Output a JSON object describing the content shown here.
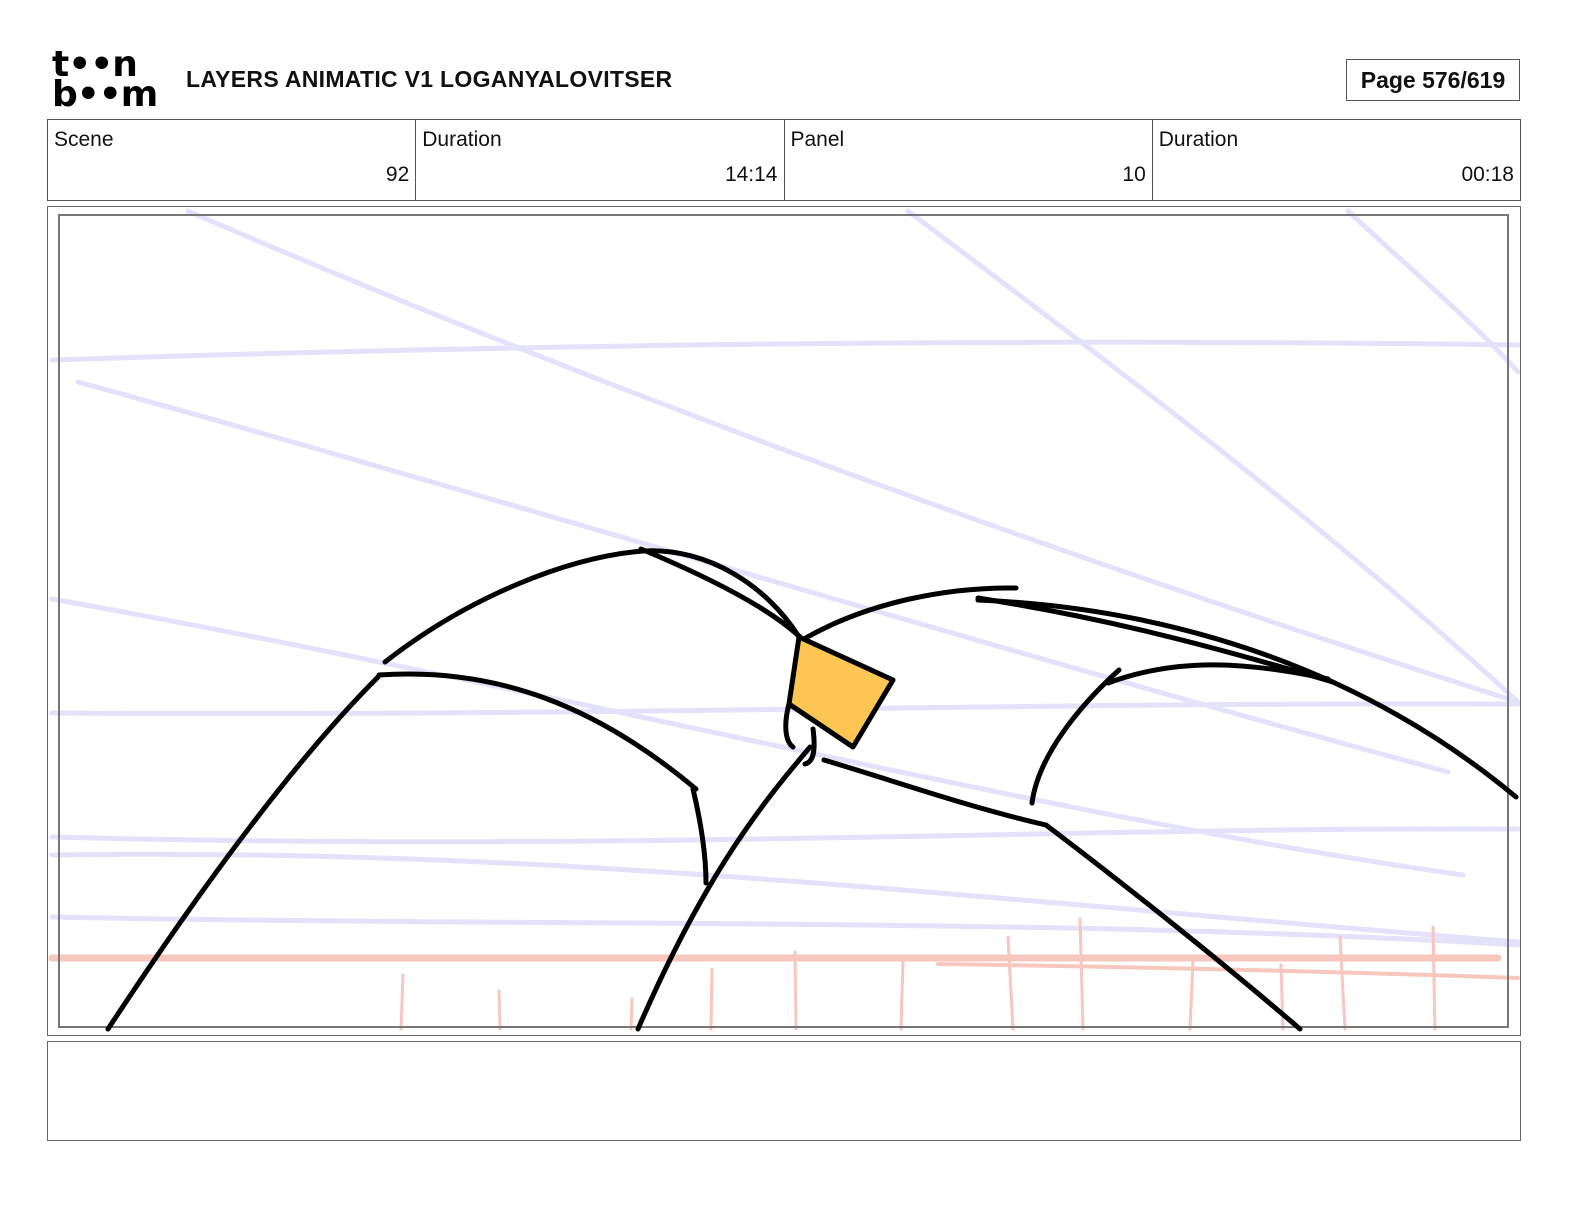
{
  "header": {
    "logo_line1": "t••n",
    "logo_line2": "b••m",
    "title": "LAYERS ANIMATIC V1 LOGANYALOVITSER",
    "page": "Page 576/619"
  },
  "info": {
    "scene_label": "Scene",
    "scene_value": "92",
    "scene_duration_label": "Duration",
    "scene_duration_value": "14:14",
    "panel_label": "Panel",
    "panel_value": "10",
    "panel_duration_label": "Duration",
    "panel_duration_value": "00:18"
  },
  "colors": {
    "guide_lines": "#e4e2fb",
    "ground_line": "#f7c6bd",
    "ink": "#000000",
    "fill_accent": "#fdc652"
  },
  "notes": {
    "text": ""
  }
}
